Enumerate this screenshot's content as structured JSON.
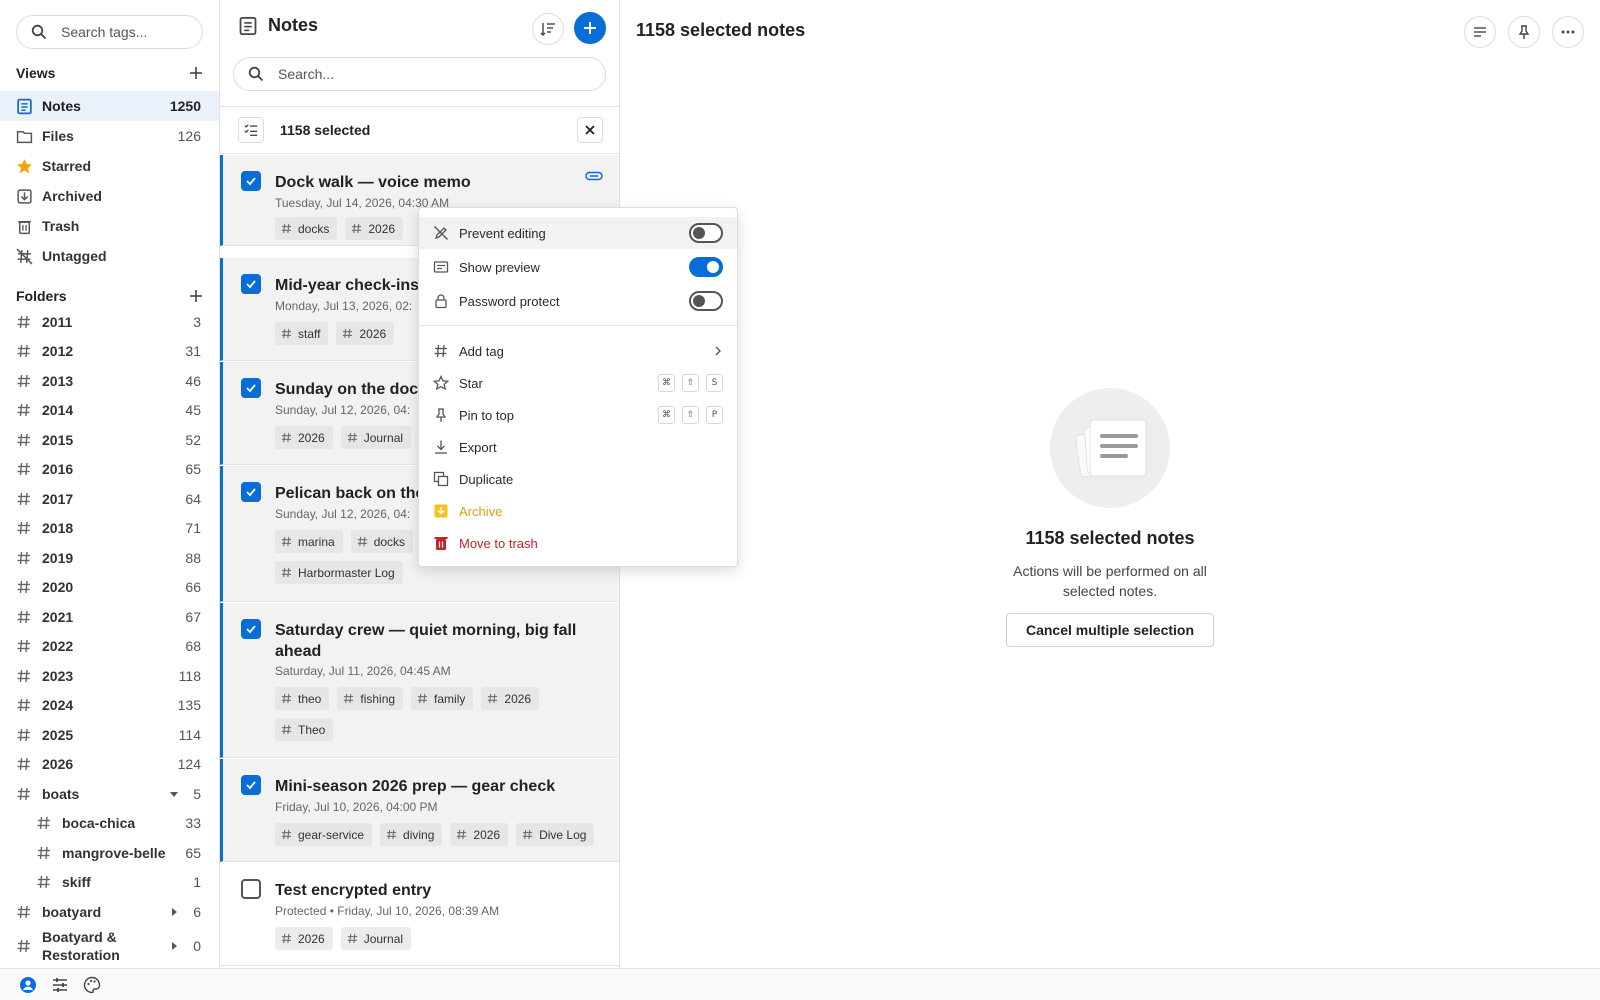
{
  "tag_search": {
    "placeholder": "Search tags..."
  },
  "views": {
    "heading": "Views",
    "items": [
      {
        "label": "Notes",
        "count": "1250"
      },
      {
        "label": "Files",
        "count": "126"
      },
      {
        "label": "Starred",
        "count": ""
      },
      {
        "label": "Archived",
        "count": ""
      },
      {
        "label": "Trash",
        "count": ""
      },
      {
        "label": "Untagged",
        "count": ""
      }
    ]
  },
  "folders": {
    "heading": "Folders",
    "items": [
      {
        "label": "2011",
        "count": "3"
      },
      {
        "label": "2012",
        "count": "31"
      },
      {
        "label": "2013",
        "count": "46"
      },
      {
        "label": "2014",
        "count": "45"
      },
      {
        "label": "2015",
        "count": "52"
      },
      {
        "label": "2016",
        "count": "65"
      },
      {
        "label": "2017",
        "count": "64"
      },
      {
        "label": "2018",
        "count": "71"
      },
      {
        "label": "2019",
        "count": "88"
      },
      {
        "label": "2020",
        "count": "66"
      },
      {
        "label": "2021",
        "count": "67"
      },
      {
        "label": "2022",
        "count": "68"
      },
      {
        "label": "2023",
        "count": "118"
      },
      {
        "label": "2024",
        "count": "135"
      },
      {
        "label": "2025",
        "count": "114"
      },
      {
        "label": "2026",
        "count": "124"
      },
      {
        "label": "boats",
        "count": "5"
      },
      {
        "label": "boca-chica",
        "count": "33"
      },
      {
        "label": "mangrove-belle",
        "count": "65"
      },
      {
        "label": "skiff",
        "count": "1"
      },
      {
        "label": "boatyard",
        "count": "6"
      },
      {
        "label": "Boatyard & Restoration",
        "count": "0"
      }
    ]
  },
  "notes_panel": {
    "title": "Notes",
    "search_placeholder": "Search...",
    "selection_text": "1158 selected"
  },
  "notes": [
    {
      "title": "Dock walk — voice memo",
      "date": "Tuesday, Jul 14, 2026, 04:30 AM",
      "tags": [
        "docks",
        "2026"
      ]
    },
    {
      "title": "Mid-year check-ins",
      "date": "Monday, Jul 13, 2026, 02:",
      "tags": [
        "staff",
        "2026"
      ]
    },
    {
      "title": "Sunday on the dock",
      "date": "Sunday, Jul 12, 2026, 04:",
      "tags": [
        "2026",
        "Journal"
      ]
    },
    {
      "title": "Pelican back on the",
      "date": "Sunday, Jul 12, 2026, 04:",
      "tags": [
        "marina",
        "docks",
        "Harbormaster Log"
      ]
    },
    {
      "title": "Saturday crew — quiet morning, big fall ahead",
      "date": "Saturday, Jul 11, 2026, 04:45 AM",
      "tags": [
        "theo",
        "fishing",
        "family",
        "2026",
        "Theo"
      ]
    },
    {
      "title": "Mini-season 2026 prep — gear check",
      "date": "Friday, Jul 10, 2026, 04:00 PM",
      "tags": [
        "gear-service",
        "diving",
        "2026",
        "Dive Log"
      ]
    },
    {
      "title": "Test encrypted entry",
      "date": "Protected • Friday, Jul 10, 2026, 08:39 AM",
      "tags": [
        "2026",
        "Journal"
      ]
    }
  ],
  "editor": {
    "title": "1158 selected notes",
    "empty_title": "1158 selected notes",
    "empty_desc": "Actions will be performed on all selected notes.",
    "cancel_label": "Cancel multiple selection"
  },
  "menu": {
    "prevent_editing": "Prevent editing",
    "show_preview": "Show preview",
    "password_protect": "Password protect",
    "add_tag": "Add tag",
    "star": "Star",
    "pin_to_top": "Pin to top",
    "export": "Export",
    "duplicate": "Duplicate",
    "archive": "Archive",
    "move_to_trash": "Move to trash",
    "shortcut_cmd": "⌘",
    "shortcut_shift": "⇧",
    "star_key": "S",
    "pin_key": "P"
  },
  "colors": {
    "accent": "#086dd6",
    "star": "#f2a40a",
    "archive": "#d6a500",
    "trash": "#cc2128"
  }
}
